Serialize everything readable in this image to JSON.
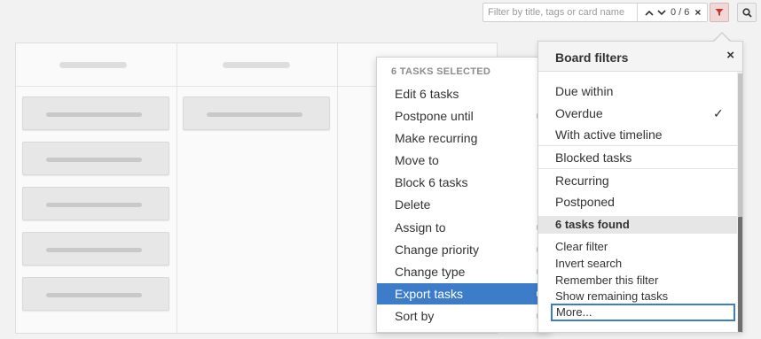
{
  "search": {
    "placeholder": "Filter by title, tags or card name",
    "value": "",
    "counter": "0 / 6",
    "clear_label": "×",
    "prev_icon": "chevron-up-icon",
    "next_icon": "chevron-down-icon"
  },
  "toolbar": {
    "filter_icon": "funnel-icon",
    "search_icon": "magnifier-icon",
    "filter_active_color": "#f1d7d7",
    "filter_icon_color": "#c0392b"
  },
  "context_menu": {
    "heading": "6 TASKS SELECTED",
    "items": [
      {
        "label": "Edit 6 tasks",
        "submenu": false,
        "active": false
      },
      {
        "label": "Postpone until",
        "submenu": true,
        "active": false
      },
      {
        "label": "Make recurring",
        "submenu": false,
        "active": false
      },
      {
        "label": "Move to",
        "submenu": false,
        "active": false
      },
      {
        "label": "Block 6 tasks",
        "submenu": false,
        "active": false
      },
      {
        "label": "Delete",
        "submenu": false,
        "active": false
      },
      {
        "label": "Assign to",
        "submenu": true,
        "active": false
      },
      {
        "label": "Change priority",
        "submenu": true,
        "active": false
      },
      {
        "label": "Change type",
        "submenu": true,
        "active": false
      },
      {
        "label": "Export tasks",
        "submenu": true,
        "active": true
      },
      {
        "label": "Sort by",
        "submenu": true,
        "active": false
      }
    ],
    "active_color": "#3d7cc9"
  },
  "filters": {
    "title": "Board filters",
    "close_label": "×",
    "due_within": "Due within",
    "overdue": "Overdue",
    "overdue_check": "✓",
    "active_timeline": "With active timeline",
    "blocked": "Blocked tasks",
    "recurring": "Recurring",
    "postponed": "Postponed",
    "tasks_found": "6 tasks found",
    "clear_filter": "Clear filter",
    "invert_search": "Invert search",
    "remember_filter": "Remember this filter",
    "show_remaining": "Show remaining tasks",
    "more": "More..."
  }
}
